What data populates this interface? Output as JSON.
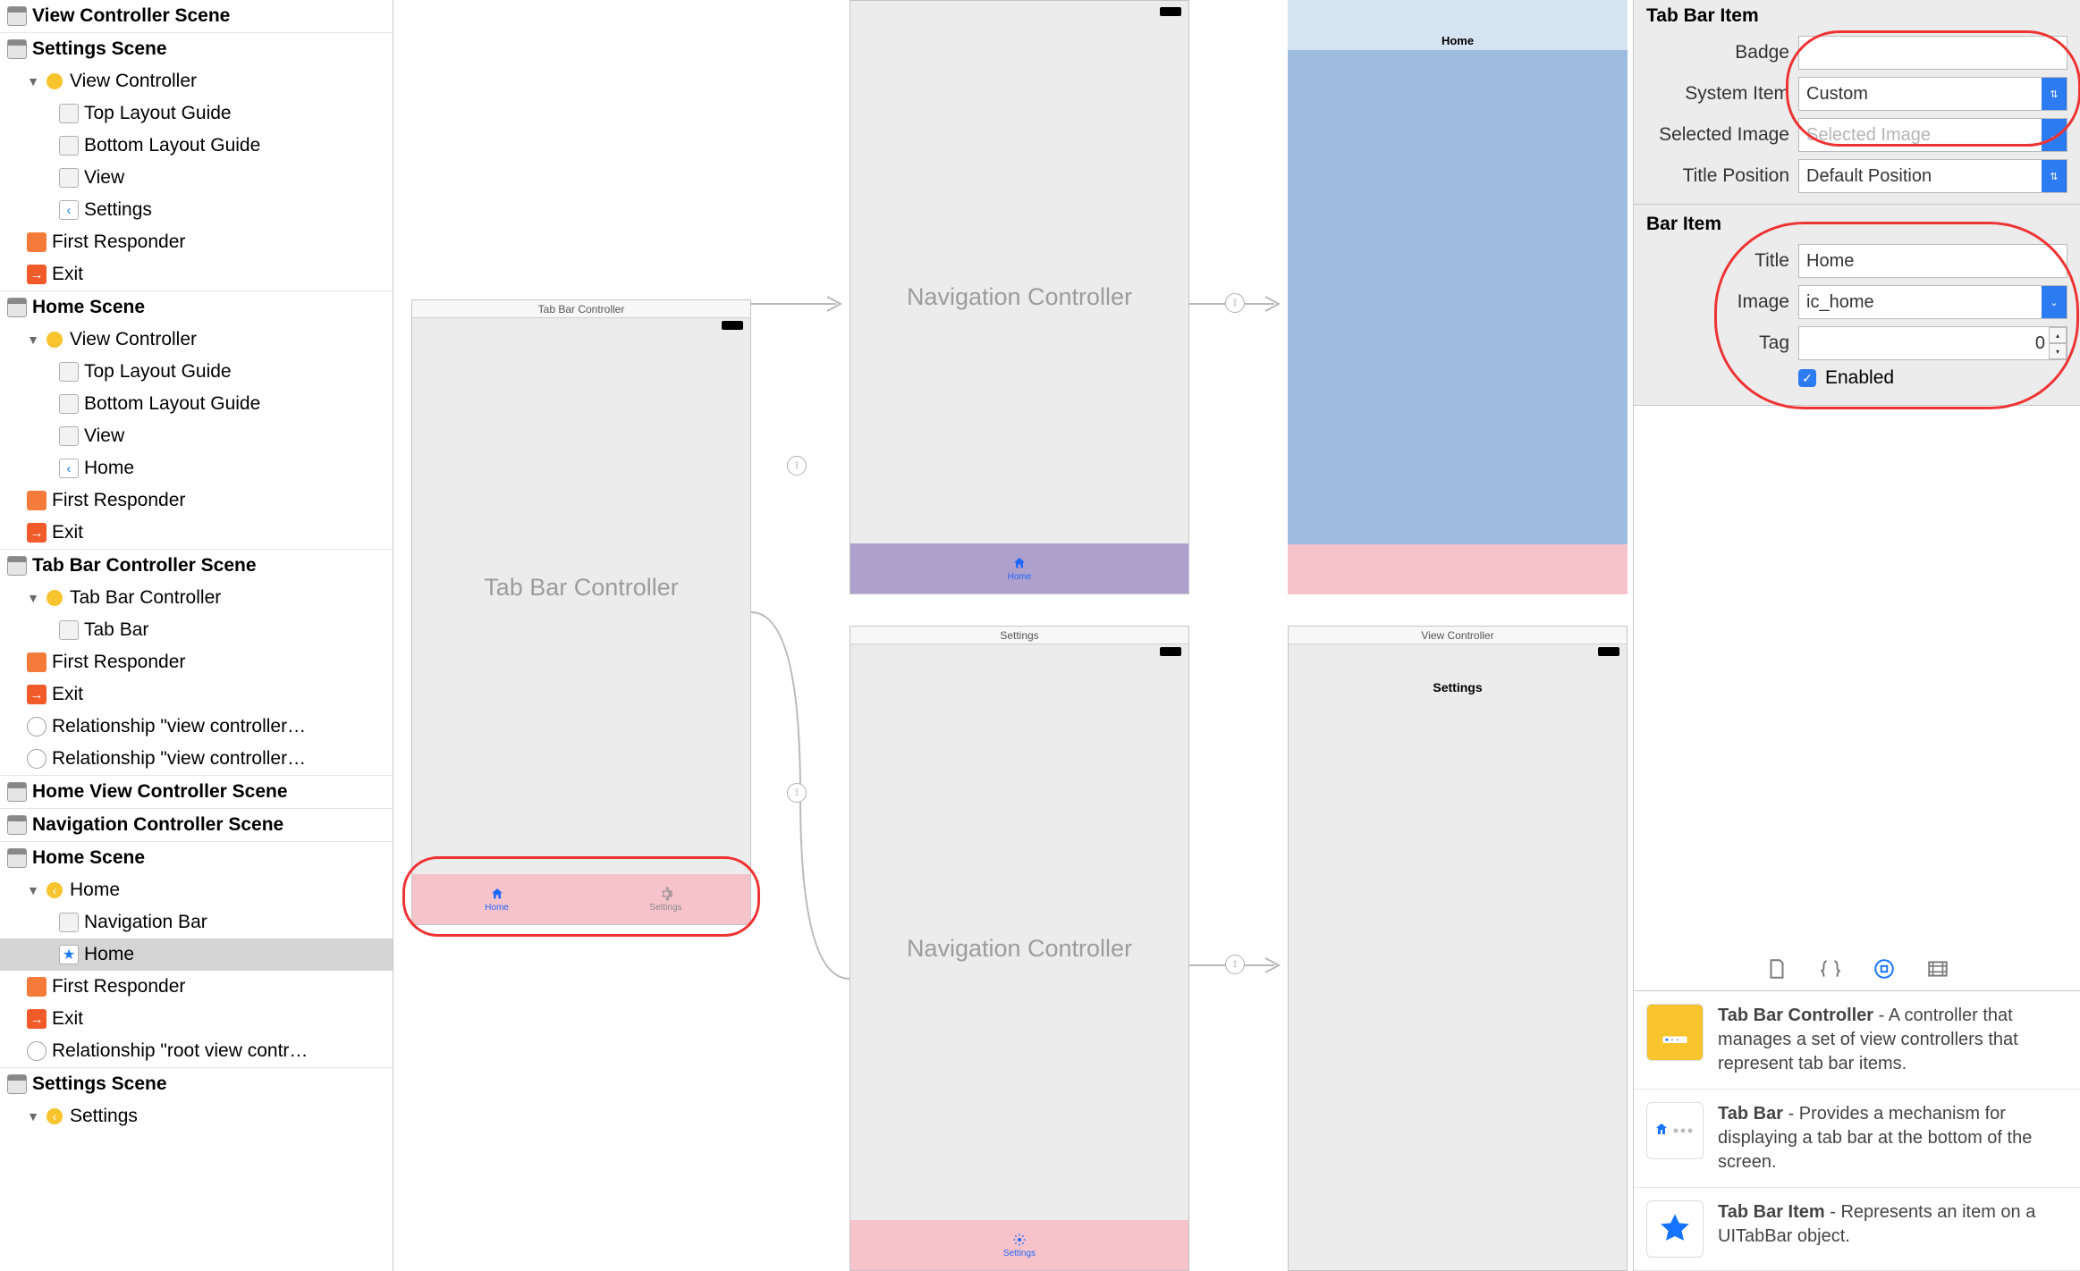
{
  "outline": {
    "scenes": [
      {
        "title": "View Controller Scene"
      },
      {
        "title": "Settings Scene",
        "vc": "View Controller",
        "items": [
          "Top Layout Guide",
          "Bottom Layout Guide",
          "View",
          "Settings"
        ],
        "first_responder": "First Responder",
        "exit": "Exit"
      },
      {
        "title": "Home Scene",
        "vc": "View Controller",
        "items": [
          "Top Layout Guide",
          "Bottom Layout Guide",
          "View",
          "Home"
        ],
        "first_responder": "First Responder",
        "exit": "Exit"
      },
      {
        "title": "Tab Bar Controller Scene",
        "vc": "Tab Bar Controller",
        "items": [
          "Tab Bar"
        ],
        "first_responder": "First Responder",
        "exit": "Exit",
        "rel1": "Relationship \"view controller…",
        "rel2": "Relationship \"view controller…"
      },
      {
        "title": "Home View Controller Scene"
      },
      {
        "title": "Navigation Controller Scene"
      },
      {
        "title": "Home Scene",
        "vc": "Home",
        "items": [
          "Navigation Bar",
          "Home"
        ],
        "first_responder": "First Responder",
        "exit": "Exit",
        "rel1": "Relationship \"root view contr…"
      },
      {
        "title": "Settings Scene",
        "vc": "Settings"
      }
    ]
  },
  "canvas": {
    "tbc_title": "Tab Bar Controller",
    "tbc_big": "Tab Bar Controller",
    "tbc_tab1": "Home",
    "tbc_tab2": "Settings",
    "nav1_big": "Navigation Controller",
    "nav1_tab": "Home",
    "nav2_title": "Settings",
    "nav2_big": "Navigation Controller",
    "nav2_tab": "Settings",
    "home_title": "Home",
    "vc_title": "View Controller",
    "vc_nav": "Settings"
  },
  "inspector": {
    "tabbar_item_title": "Tab Bar Item",
    "badge_label": "Badge",
    "badge_value": "",
    "system_item_label": "System Item",
    "system_item_value": "Custom",
    "selected_image_label": "Selected Image",
    "selected_image_placeholder": "Selected Image",
    "title_position_label": "Title Position",
    "title_position_value": "Default Position",
    "bar_item_title": "Bar Item",
    "title_label": "Title",
    "title_value": "Home",
    "image_label": "Image",
    "image_value": "ic_home",
    "tag_label": "Tag",
    "tag_value": "0",
    "enabled_label": "Enabled",
    "enabled_checked": true
  },
  "library": {
    "items": [
      {
        "name": "Tab Bar Controller",
        "desc": " - A controller that manages a set of view controllers that represent tab bar items."
      },
      {
        "name": "Tab Bar",
        "desc": " - Provides a mechanism for displaying a tab bar at the bottom of the screen."
      },
      {
        "name": "Tab Bar Item",
        "desc": " - Represents an item on a UITabBar object."
      }
    ]
  }
}
